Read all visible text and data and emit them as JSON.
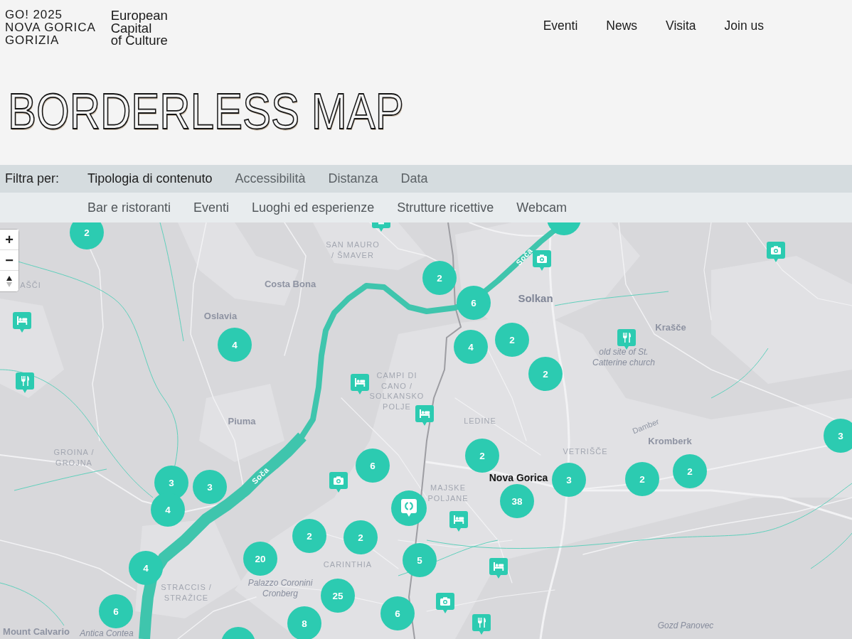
{
  "header": {
    "logo_lines": [
      "GO! 2025",
      "NOVA GORICA",
      "GORIZIA"
    ],
    "tagline_lines": [
      "European",
      "Capital",
      "of Culture"
    ],
    "nav": [
      "Eventi",
      "News",
      "Visita",
      "Join us"
    ]
  },
  "page_title": "BORDERLESS MAP",
  "filters": {
    "label": "Filtra per:",
    "tabs": [
      {
        "label": "Tipologia di contenuto",
        "selected": true
      },
      {
        "label": "Accessibilità",
        "selected": false
      },
      {
        "label": "Distanza",
        "selected": false
      },
      {
        "label": "Data",
        "selected": false
      }
    ],
    "options": [
      "Bar e ristoranti",
      "Eventi",
      "Luoghi ed esperienze",
      "Strutture ricettive",
      "Webcam"
    ]
  },
  "map": {
    "zoom_in": "+",
    "zoom_out": "−",
    "labels": [
      {
        "kind": "district",
        "lines": [
          "AŠČI"
        ]
      },
      {
        "kind": "district",
        "lines": [
          "SAN MAURO",
          "/ ŠMAVER"
        ]
      },
      {
        "kind": "place",
        "lines": [
          "Costa Bona"
        ]
      },
      {
        "kind": "place",
        "lines": [
          "Oslavia"
        ]
      },
      {
        "kind": "town",
        "lines": [
          "Solkan"
        ]
      },
      {
        "kind": "place",
        "lines": [
          "Krašče"
        ]
      },
      {
        "kind": "poi",
        "lines": [
          "old site of St.",
          "Catterine church"
        ]
      },
      {
        "kind": "district",
        "lines": [
          "CAMPI DI",
          "CANO /",
          "SOLKANSKO",
          "POLJE"
        ]
      },
      {
        "kind": "place",
        "lines": [
          "Piuma"
        ]
      },
      {
        "kind": "district",
        "lines": [
          "LEDINE"
        ]
      },
      {
        "kind": "street",
        "lines": [
          "Damber"
        ]
      },
      {
        "kind": "district",
        "lines": [
          "VETRIŠČE"
        ]
      },
      {
        "kind": "place",
        "lines": [
          "Kromberk"
        ]
      },
      {
        "kind": "district",
        "lines": [
          "GROINA /",
          "GROJNA"
        ]
      },
      {
        "kind": "city",
        "lines": [
          "Nova Gorica"
        ]
      },
      {
        "kind": "district",
        "lines": [
          "MAJSKE",
          "POLJANE"
        ]
      },
      {
        "kind": "river",
        "lines": [
          "Soča"
        ]
      },
      {
        "kind": "river",
        "lines": [
          "Soča"
        ]
      },
      {
        "kind": "district",
        "lines": [
          "STRACCIS /",
          "STRAŽICE"
        ]
      },
      {
        "kind": "district",
        "lines": [
          "CARINTHIA"
        ]
      },
      {
        "kind": "poi",
        "lines": [
          "Palazzo Coronini",
          "Cronberg"
        ]
      },
      {
        "kind": "place",
        "lines": [
          "Mount Calvario"
        ]
      },
      {
        "kind": "poi",
        "lines": [
          "Antica Contea"
        ]
      },
      {
        "kind": "poi",
        "lines": [
          "Gozd Panovec"
        ]
      }
    ],
    "clusters": [
      {
        "count": "2"
      },
      {
        "count": "2"
      },
      {
        "count": "6"
      },
      {
        "count": "4"
      },
      {
        "count": "4"
      },
      {
        "count": "2"
      },
      {
        "count": "2"
      },
      {
        "count": "6"
      },
      {
        "count": "2"
      },
      {
        "count": "3"
      },
      {
        "count": "3"
      },
      {
        "count": "4"
      },
      {
        "count": "3"
      },
      {
        "count": "2"
      },
      {
        "count": "2"
      },
      {
        "count": "3"
      },
      {
        "count": "38"
      },
      {
        "count": "2"
      },
      {
        "count": "2"
      },
      {
        "count": "20"
      },
      {
        "count": "4"
      },
      {
        "count": "5"
      },
      {
        "count": "25"
      },
      {
        "count": "6"
      },
      {
        "count": "6"
      },
      {
        "count": "8"
      }
    ],
    "pins": [
      {
        "kind": "monument"
      },
      {
        "kind": "camera"
      },
      {
        "kind": "camera"
      },
      {
        "kind": "bed"
      },
      {
        "kind": "food"
      },
      {
        "kind": "food"
      },
      {
        "kind": "bed"
      },
      {
        "kind": "bed"
      },
      {
        "kind": "camera"
      },
      {
        "kind": "bed"
      },
      {
        "kind": "bed"
      },
      {
        "kind": "camera"
      },
      {
        "kind": "food"
      }
    ]
  }
}
